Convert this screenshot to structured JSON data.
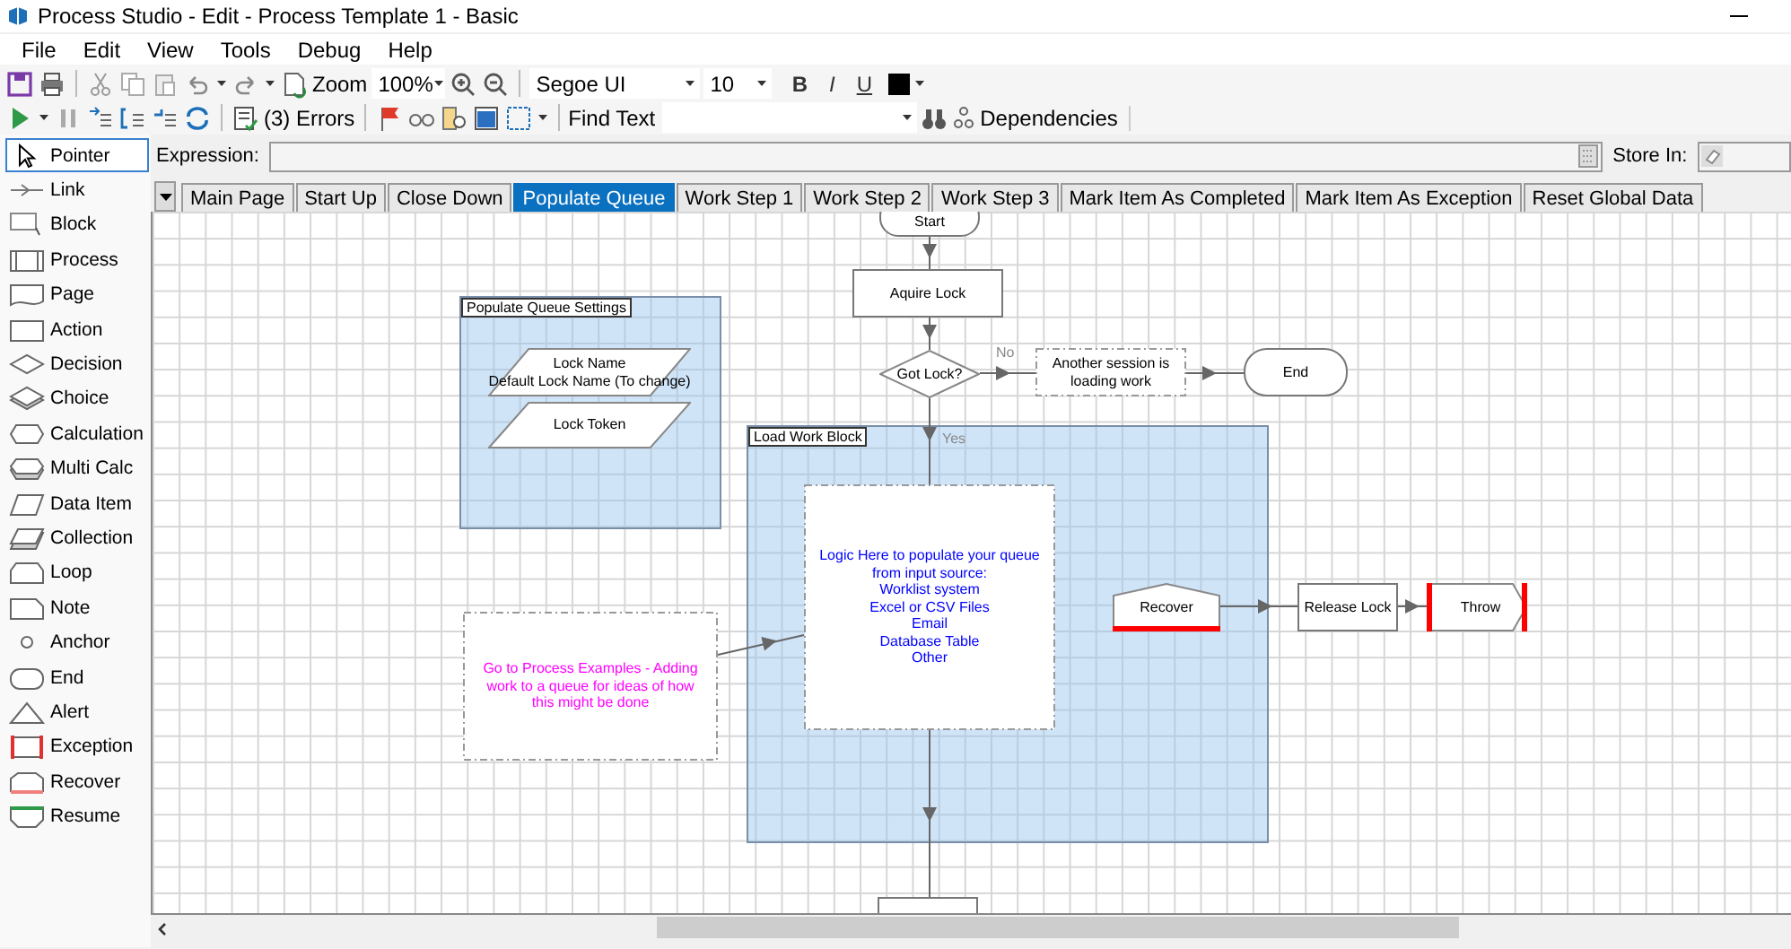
{
  "window": {
    "title": "Process Studio  - Edit - Process Template 1 - Basic"
  },
  "menu": [
    "File",
    "Edit",
    "View",
    "Tools",
    "Debug",
    "Help"
  ],
  "toolbar": {
    "zoom_label": "Zoom",
    "zoom": "100%",
    "font": "Segoe UI",
    "font_size": "10",
    "bold": "B",
    "italic": "I",
    "underline": "U",
    "errors": "(3) Errors",
    "find_label": "Find Text",
    "dependencies": "Dependencies"
  },
  "palette": [
    {
      "label": "Pointer",
      "selected": true
    },
    {
      "label": "Link",
      "selected": false
    },
    {
      "label": "Block",
      "selected": false
    },
    {
      "label": "Process",
      "selected": false
    },
    {
      "label": "Page",
      "selected": false
    },
    {
      "label": "Action",
      "selected": false
    },
    {
      "label": "Decision",
      "selected": false
    },
    {
      "label": "Choice",
      "selected": false
    },
    {
      "label": "Calculation",
      "selected": false
    },
    {
      "label": "Multi Calc",
      "selected": false
    },
    {
      "label": "Data Item",
      "selected": false
    },
    {
      "label": "Collection",
      "selected": false
    },
    {
      "label": "Loop",
      "selected": false
    },
    {
      "label": "Note",
      "selected": false
    },
    {
      "label": "Anchor",
      "selected": false
    },
    {
      "label": "End",
      "selected": false
    },
    {
      "label": "Alert",
      "selected": false
    },
    {
      "label": "Exception",
      "selected": false
    },
    {
      "label": "Recover",
      "selected": false
    },
    {
      "label": "Resume",
      "selected": false
    }
  ],
  "expression": {
    "label": "Expression:",
    "store_label": "Store In:"
  },
  "tabs": [
    {
      "label": "Main Page",
      "selected": false
    },
    {
      "label": "Start Up",
      "selected": false
    },
    {
      "label": "Close Down",
      "selected": false
    },
    {
      "label": "Populate Queue",
      "selected": true
    },
    {
      "label": "Work Step 1",
      "selected": false
    },
    {
      "label": "Work Step 2",
      "selected": false
    },
    {
      "label": "Work Step 3",
      "selected": false
    },
    {
      "label": "Mark Item As Completed",
      "selected": false
    },
    {
      "label": "Mark Item As Exception",
      "selected": false
    },
    {
      "label": "Reset Global Data",
      "selected": false
    }
  ],
  "diagram": {
    "blocks": [
      {
        "label": "Populate Queue Settings"
      },
      {
        "label": "Load Work Block"
      }
    ],
    "nodes": [
      {
        "kind": "start",
        "lines": [
          "Start"
        ]
      },
      {
        "kind": "action",
        "lines": [
          "Aquire Lock"
        ]
      },
      {
        "kind": "data",
        "lines": [
          "Lock Name",
          "Default Lock Name (To change)"
        ]
      },
      {
        "kind": "decision",
        "lines": [
          "Got Lock?"
        ]
      },
      {
        "kind": "note",
        "color": "#000000",
        "lines": [
          "Another session is",
          "loading work"
        ]
      },
      {
        "kind": "end",
        "lines": [
          "End"
        ]
      },
      {
        "kind": "data",
        "lines": [
          "Lock Token"
        ]
      },
      {
        "kind": "note",
        "color": "#0000ff",
        "lines": [
          "Logic Here to populate your queue",
          "from input source:",
          "Worklist system",
          "Excel or CSV Files",
          "Email",
          "Database Table",
          "Other"
        ]
      },
      {
        "kind": "note",
        "color": "#ff00ff",
        "lines": [
          "Go to  Process Examples - Adding",
          "work to a queue for ideas of how",
          "this might be done"
        ]
      },
      {
        "kind": "recover",
        "lines": [
          "Recover"
        ]
      },
      {
        "kind": "action",
        "lines": [
          "Release Lock"
        ]
      },
      {
        "kind": "exception",
        "lines": [
          "Throw"
        ]
      },
      {
        "kind": "action"
      }
    ],
    "connector_labels": [
      "No",
      "Yes"
    ]
  }
}
